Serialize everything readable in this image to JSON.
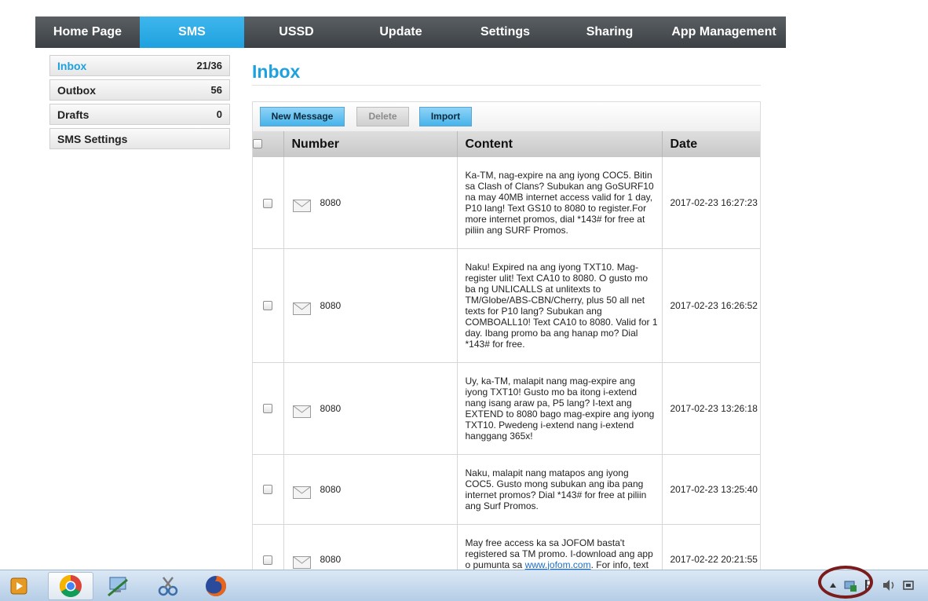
{
  "nav": {
    "items": [
      "Home Page",
      "SMS",
      "USSD",
      "Update",
      "Settings",
      "Sharing",
      "App Management"
    ],
    "active": "SMS"
  },
  "sidebar": {
    "items": [
      {
        "label": "Inbox",
        "count": "21/36"
      },
      {
        "label": "Outbox",
        "count": "56"
      },
      {
        "label": "Drafts",
        "count": "0"
      },
      {
        "label": "SMS Settings",
        "count": ""
      }
    ],
    "active": "Inbox"
  },
  "page": {
    "title": "Inbox"
  },
  "toolbar": {
    "new_message": "New Message",
    "delete": "Delete",
    "import": "Import"
  },
  "table": {
    "headers": {
      "number": "Number",
      "content": "Content",
      "date": "Date"
    },
    "rows": [
      {
        "number": "8080",
        "content": "Ka-TM, nag-expire na ang iyong COC5. Bitin sa Clash of Clans? Subukan ang GoSURF10 na may 40MB internet access valid for 1 day, P10 lang! Text GS10 to 8080 to register.For more internet promos, dial *143# for free at piliin ang SURF Promos.",
        "date": "2017-02-23 16:27:23"
      },
      {
        "number": "8080",
        "content": "Naku! Expired na ang iyong TXT10. Mag-register ulit! Text CA10 to 8080. O gusto mo ba ng UNLICALLS at unlitexts to TM/Globe/ABS-CBN/Cherry, plus 50 all net texts for P10 lang? Subukan ang COMBOALL10! Text CA10 to 8080. Valid for 1 day. Ibang promo ba ang hanap mo? Dial *143# for free.",
        "date": "2017-02-23 16:26:52"
      },
      {
        "number": "8080",
        "content": "Uy, ka-TM, malapit nang mag-expire ang iyong TXT10! Gusto mo ba itong i-extend nang isang araw pa, P5 lang? I-text ang EXTEND to 8080 bago mag-expire ang iyong TXT10. Pwedeng i-extend nang i-extend hanggang 365x!",
        "date": "2017-02-23 13:26:18"
      },
      {
        "number": "8080",
        "content": "Naku, malapit nang matapos ang iyong COC5. Gusto mong subukan ang iba pang internet promos? Dial *143# for free at piliin ang Surf Promos.",
        "date": "2017-02-23 13:25:40"
      },
      {
        "number": "8080",
        "content_before": "May free access ka sa JOFOM basta't registered sa TM promo. I-download ang app o pumunta sa ",
        "content_link": "www.jofom.com",
        "content_after": ". For info, text",
        "date": "2017-02-22 20:21:55"
      }
    ]
  },
  "taskbar": {
    "apps": [
      "media-player-icon",
      "chrome-icon",
      "network-connect-icon",
      "snipping-tool-icon",
      "firefox-icon"
    ]
  }
}
